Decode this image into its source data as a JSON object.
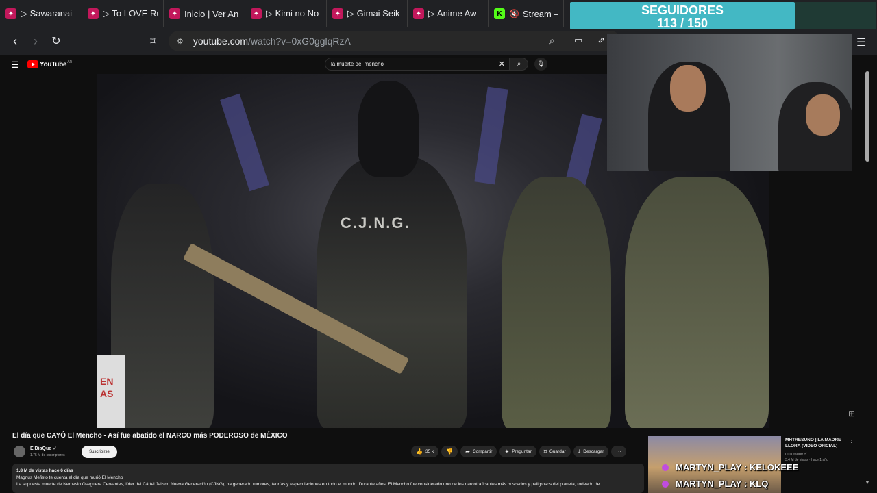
{
  "browser": {
    "tabs": [
      {
        "label": "▷ Sawaranai",
        "favicon": "anime-favicon"
      },
      {
        "label": "▷ To LOVE Ru",
        "favicon": "anime-favicon"
      },
      {
        "label": "Inicio | Ver An",
        "favicon": "anime-favicon"
      },
      {
        "label": "▷ Kimi no No",
        "favicon": "anime-favicon"
      },
      {
        "label": "▷ Gimai Seik",
        "favicon": "anime-favicon"
      },
      {
        "label": "▷ Anime Aw",
        "favicon": "anime-favicon"
      },
      {
        "label": "Stream –",
        "favicon": "kick-favicon"
      }
    ],
    "url_host": "youtube.com",
    "url_path": "/watch?v=0xG0gglqRzA"
  },
  "youtube": {
    "logo_text": "YouTube",
    "logo_region": "AR",
    "search_query": "la muerte del mencho"
  },
  "video": {
    "vest_text": "C.J.N.G.",
    "sign_text": "EN\nAS",
    "title": "El día que CAYÓ El Mencho - Así fue abatido el NARCO más PODEROSO de MÉXICO",
    "channel": "ElDiaQue",
    "subscribers": "1.75 M de suscriptores",
    "subscribe_label": "Suscribirse",
    "likes": "35 k",
    "share_label": "Compartir",
    "ask_label": "Preguntar",
    "save_label": "Guardar",
    "download_label": "Descargar",
    "views_line": "1.8 M de vistas  hace 6 días",
    "desc_line1": "Magnus Mefisto te cuenta el día que murió El Mencho",
    "desc_line2": "La supuesta muerte de Nemesio Oseguera Cervantes, líder del Cártel Jalisco Nueva Generación (CJNG), ha generado rumores, teorías y especulaciones en todo el mundo. Durante años, El Mencho fue considerado uno de los narcotraficantes más buscados y peligrosos del planeta, rodeado de"
  },
  "recommendation": {
    "title": "MHTRESUNO | LA MADRE LLORA (VIDEO OFICIAL)",
    "channel": "mhtresuno",
    "meta": "3.4 M de vistas · hace 1 año"
  },
  "overlay": {
    "followers_label": "SEGUIDORES",
    "followers_count": "113 / 150",
    "followers_progress": 0.753,
    "chat": [
      {
        "user": "MARTYN_PLAY",
        "message": "KELOKEEE"
      },
      {
        "user": "MARTYN_PLAY",
        "message": "KLQ"
      }
    ]
  }
}
